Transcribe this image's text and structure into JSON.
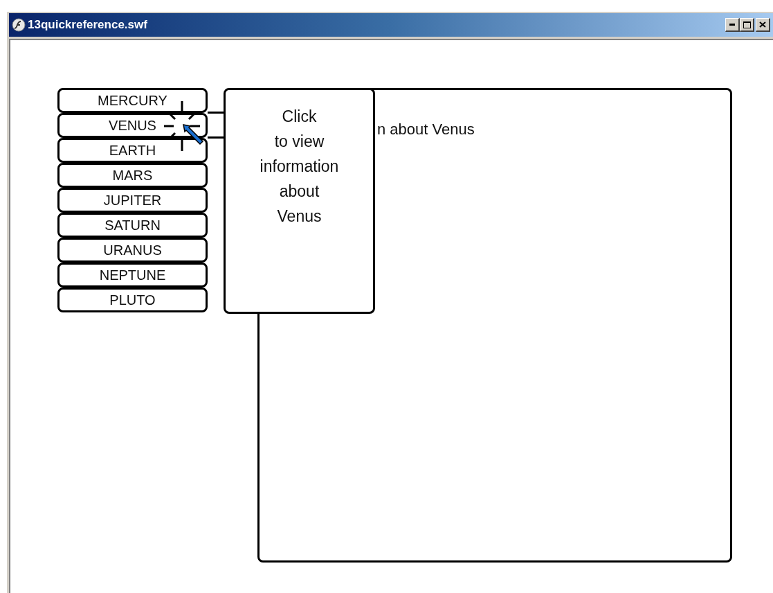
{
  "window": {
    "title": "13quickreference.swf"
  },
  "planets": [
    "MERCURY",
    "VENUS",
    "EARTH",
    "MARS",
    "JUPITER",
    "SATURN",
    "URANUS",
    "NEPTUNE",
    "PLUTO"
  ],
  "tooltip": {
    "text": "Click\nto view\ninformation\nabout\nVenus"
  },
  "info_panel": {
    "text": "n about Venus"
  }
}
